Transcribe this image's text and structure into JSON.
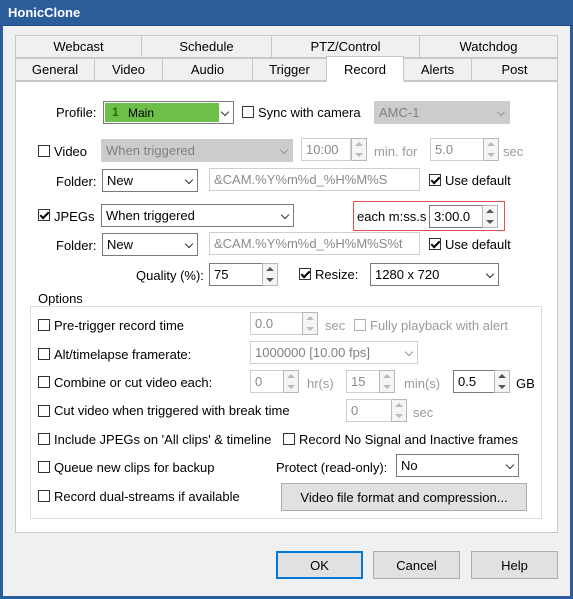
{
  "window": {
    "title": "HonicClone"
  },
  "tabs_top": [
    "Webcast",
    "Schedule",
    "PTZ/Control",
    "Watchdog"
  ],
  "tabs_bottom": [
    "General",
    "Video",
    "Audio",
    "Trigger",
    "Record",
    "Alerts",
    "Post"
  ],
  "profile": {
    "label": "Profile:",
    "value": "Main",
    "number": "1",
    "sync_label": "Sync with camera",
    "camera": "AMC-1"
  },
  "video": {
    "label": "Video",
    "trigger": "When triggered",
    "time": "10:00",
    "min_for": "min. for",
    "secs": "5.0",
    "sec": "sec",
    "folder_label": "Folder:",
    "folder": "New",
    "path": "&CAM.%Y%m%d_%H%M%S",
    "use_default": "Use default"
  },
  "jpegs": {
    "label": "JPEGs",
    "trigger": "When triggered",
    "each_label": "each m:ss.s",
    "each_value": "3:00.0",
    "folder_label": "Folder:",
    "folder": "New",
    "path": "&CAM.%Y%m%d_%H%M%S%t",
    "use_default": "Use default",
    "quality_label": "Quality (%):",
    "quality": "75",
    "resize_label": "Resize:",
    "resize": "1280 x 720"
  },
  "options": {
    "title": "Options",
    "pretrigger_label": "Pre-trigger record time",
    "pretrigger_value": "0.0",
    "pretrigger_unit": "sec",
    "full_playback": "Fully playback with alert",
    "timelapse_label": "Alt/timelapse framerate:",
    "timelapse_value": "1000000 [10.00 fps]",
    "combine_label": "Combine or cut video each:",
    "hrs": "0",
    "hrs_unit": "hr(s)",
    "mins": "15",
    "mins_unit": "min(s)",
    "gb": "0.5",
    "gb_unit": "GB",
    "cut_break_label": "Cut video when triggered with break time",
    "break_value": "0",
    "break_unit": "sec",
    "include_jpegs": "Include JPEGs on 'All clips' & timeline",
    "no_signal": "Record No Signal and Inactive frames",
    "queue_label": "Queue new clips for backup",
    "protect_label": "Protect (read-only):",
    "protect_value": "No",
    "dual_streams": "Record dual-streams if available",
    "format_button": "Video file format and compression..."
  },
  "buttons": {
    "ok": "OK",
    "cancel": "Cancel",
    "help": "Help"
  },
  "colors": {
    "titlebar": "#2b5d9b",
    "profile_bg": "#6cc04a",
    "highlight": "#e05050"
  }
}
